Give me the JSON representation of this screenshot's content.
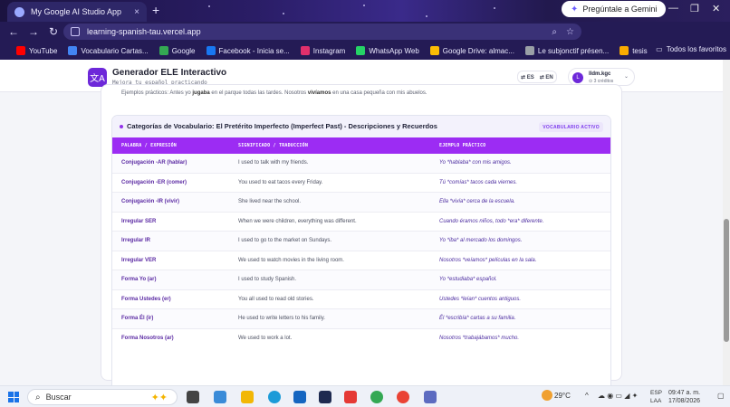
{
  "browser": {
    "tab_title": "My Google AI Studio App",
    "tab_close": "×",
    "new_tab": "+",
    "gemini_button": "Pregúntale a Gemini",
    "window_controls": [
      "—",
      "❐",
      "✕"
    ],
    "nav": {
      "back": "←",
      "forward": "→",
      "reload": "↻"
    },
    "url": "learning-spanish-tau.vercel.app",
    "bookmarks": [
      {
        "label": "YouTube",
        "color": "#ff0000"
      },
      {
        "label": "Vocabulario Cartas...",
        "color": "#4285f4"
      },
      {
        "label": "Google",
        "color": "#34a853"
      },
      {
        "label": "Facebook - Inicia se...",
        "color": "#1877f2"
      },
      {
        "label": "Instagram",
        "color": "#e1306c"
      },
      {
        "label": "WhatsApp Web",
        "color": "#25d366"
      },
      {
        "label": "Google Drive: almac...",
        "color": "#fbbc04"
      },
      {
        "label": "Le subjonctif présen...",
        "color": "#9aa0a6"
      },
      {
        "label": "tesis",
        "color": "#f9ab00"
      }
    ],
    "bookmarks_more": "Todos los favoritos"
  },
  "app": {
    "logo_glyph": "文A",
    "title": "Generador ELE Interactivo",
    "subtitle": "Mejora tu español practicando",
    "lang_es": "ES",
    "lang_en": "EN",
    "user_initial": "L",
    "user_name": "lldm.kgc",
    "user_credits": "3 créditos",
    "examples_prefix": "Ejemplos prácticos: Antes yo ",
    "examples_b1": "jugaba",
    "examples_mid": " en el parque todas las tardes. Nosotros ",
    "examples_b2": "vivíamos",
    "examples_suffix": " en una casa pequeña con mis abuelos."
  },
  "vocab": {
    "title": "Categorías de Vocabulario: El Pretérito Imperfecto (Imperfect Past) - Descripciones y Recuerdos",
    "badge": "VOCABULARIO ACTIVO",
    "headers": [
      "PALABRA / EXPRESIÓN",
      "SIGNIFICADO / TRADUCCIÓN",
      "EJEMPLO PRÁCTICO"
    ],
    "rows": [
      [
        "Conjugación -AR (hablar)",
        "I used to talk with my friends.",
        "Yo *hablaba* con mis amigos."
      ],
      [
        "Conjugación -ER (comer)",
        "You used to eat tacos every Friday.",
        "Tú *comías* tacos cada viernes."
      ],
      [
        "Conjugación -IR (vivir)",
        "She lived near the school.",
        "Ella *vivía* cerca de la escuela."
      ],
      [
        "Irregular SER",
        "When we were children, everything was different.",
        "Cuando éramos niños, todo *era* diferente."
      ],
      [
        "Irregular IR",
        "I used to go to the market on Sundays.",
        "Yo *iba* al mercado los domingos."
      ],
      [
        "Irregular VER",
        "We used to watch movies in the living room.",
        "Nosotros *veíamos* películas en la sala."
      ],
      [
        "Forma Yo (ar)",
        "I used to study Spanish.",
        "Yo *estudiaba* español."
      ],
      [
        "Forma Ustedes (er)",
        "You all used to read old stories.",
        "Ustedes *leían* cuentos antiguos."
      ],
      [
        "Forma Él (ir)",
        "He used to write letters to his family.",
        "Él *escribía* cartas a su familia."
      ],
      [
        "Forma Nosotros (ar)",
        "We used to work a lot.",
        "Nosotros *trabajábamos* mucho."
      ]
    ]
  },
  "taskbar": {
    "search_placeholder": "Buscar",
    "weather": "29°C",
    "lang": "ESP",
    "lang2": "LAA",
    "time": "09:47 a. m.",
    "date": "17/08/2026"
  }
}
